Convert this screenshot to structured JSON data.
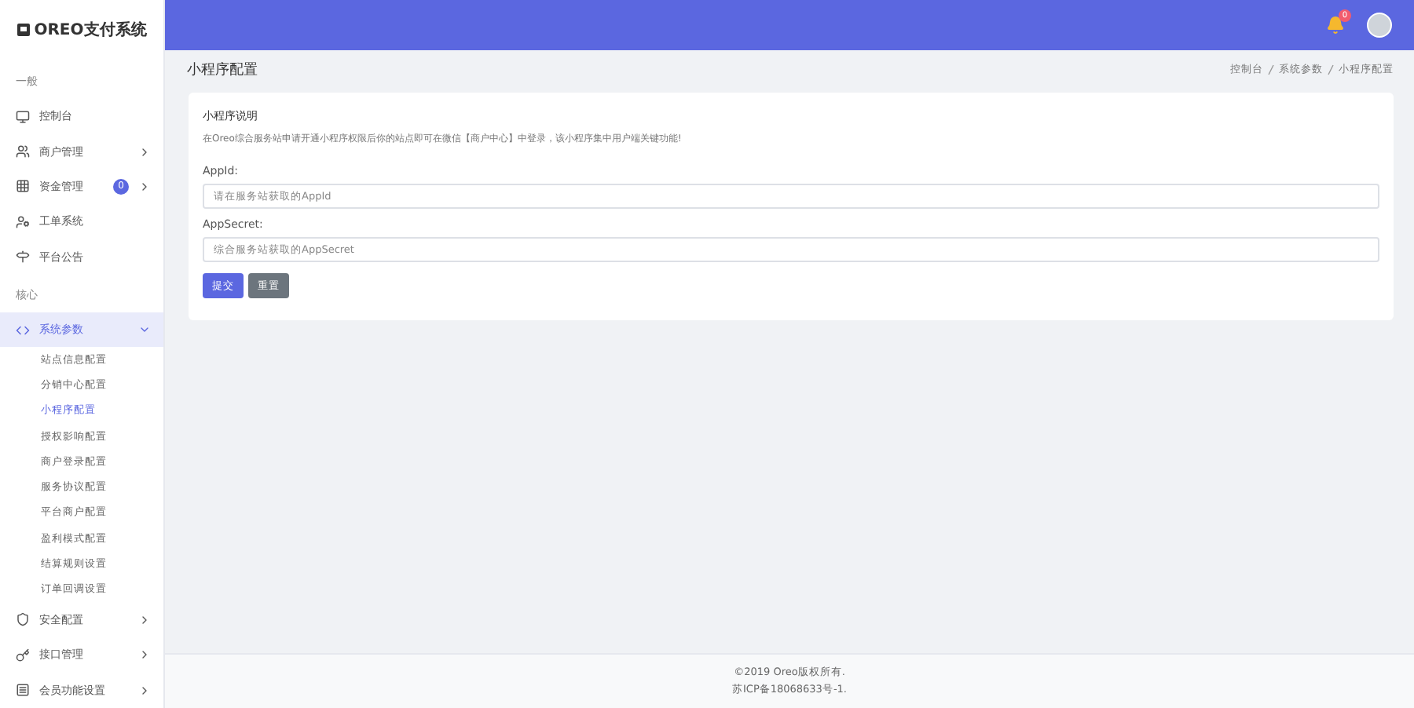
{
  "brand": {
    "name": "OREO支付系统"
  },
  "header": {
    "notification_count": "0"
  },
  "sidebar": {
    "sections": [
      {
        "title": "一般",
        "items": [
          {
            "label": "控制台",
            "kind": "link",
            "selected": false
          },
          {
            "label": "商户管理",
            "kind": "group",
            "selected": false,
            "expanded": false
          },
          {
            "label": "资金管理",
            "kind": "group",
            "selected": false,
            "expanded": false,
            "badge": "0"
          },
          {
            "label": "工单系统",
            "kind": "link",
            "selected": false
          },
          {
            "label": "平台公告",
            "kind": "link",
            "selected": false
          }
        ]
      },
      {
        "title": "核心",
        "items": [
          {
            "label": "系统参数",
            "kind": "group",
            "selected": true,
            "expanded": true,
            "children": [
              {
                "label": "站点信息配置",
                "selected": false
              },
              {
                "label": "分销中心配置",
                "selected": false
              },
              {
                "label": "小程序配置",
                "selected": true
              },
              {
                "label": "授权影响配置",
                "selected": false
              },
              {
                "label": "商户登录配置",
                "selected": false
              },
              {
                "label": "服务协议配置",
                "selected": false
              },
              {
                "label": "平台商户配置",
                "selected": false
              },
              {
                "label": "盈利模式配置",
                "selected": false
              },
              {
                "label": "结算规则设置",
                "selected": false
              },
              {
                "label": "订单回调设置",
                "selected": false
              }
            ]
          },
          {
            "label": "安全配置",
            "kind": "group",
            "selected": false,
            "expanded": false
          },
          {
            "label": "接口管理",
            "kind": "group",
            "selected": false,
            "expanded": false
          },
          {
            "label": "会员功能设置",
            "kind": "group",
            "selected": false,
            "expanded": false
          }
        ]
      }
    ]
  },
  "page": {
    "title": "小程序配置",
    "breadcrumb": [
      "控制台",
      "系统参数",
      "小程序配置"
    ]
  },
  "card": {
    "heading": "小程序说明",
    "description": "在Oreo综合服务站申请开通小程序权限后你的站点即可在微信【商户中心】中登录，该小程序集中用户端关键功能!",
    "fields": [
      {
        "label": "AppId:",
        "placeholder": "请在服务站获取的AppId"
      },
      {
        "label": "AppSecret:",
        "placeholder": "综合服务站获取的AppSecret"
      }
    ],
    "buttons": [
      {
        "label": "提交",
        "kind": "primary"
      },
      {
        "label": "重置",
        "kind": "secondary"
      }
    ]
  },
  "footer": {
    "lines": [
      "©2019 Oreo版权所有.",
      "苏ICP备18068633号-1."
    ]
  }
}
